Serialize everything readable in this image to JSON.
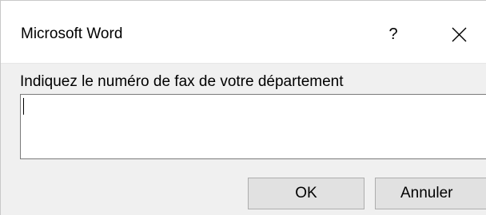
{
  "window": {
    "title": "Microsoft Word",
    "help_label": "?",
    "close_icon": "close-icon"
  },
  "prompt": {
    "label": "Indiquez le numéro de fax de votre département",
    "value": ""
  },
  "buttons": {
    "ok_label": "OK",
    "cancel_label": "Annuler"
  },
  "colors": {
    "dialog_background": "#f0f0f0",
    "titlebar_background": "#ffffff",
    "button_background": "#e1e1e1",
    "button_border": "#adadad",
    "input_border": "#7a7a7a"
  }
}
